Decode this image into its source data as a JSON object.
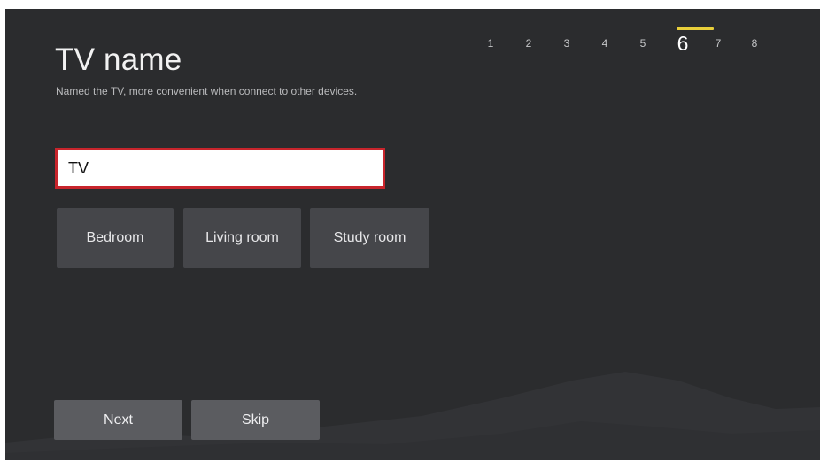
{
  "page": {
    "title": "TV name",
    "subtitle": "Named the TV, more convenient when connect to other devices."
  },
  "steps": {
    "items": [
      "1",
      "2",
      "3",
      "4",
      "5",
      "6",
      "7",
      "8"
    ],
    "current": "6",
    "current_index": 5,
    "accent_color": "#e8cf3a"
  },
  "name_field": {
    "value": "TV",
    "border_color": "#c8252c"
  },
  "presets": {
    "bedroom": "Bedroom",
    "living_room": "Living room",
    "study_room": "Study room"
  },
  "actions": {
    "next": "Next",
    "skip": "Skip"
  }
}
